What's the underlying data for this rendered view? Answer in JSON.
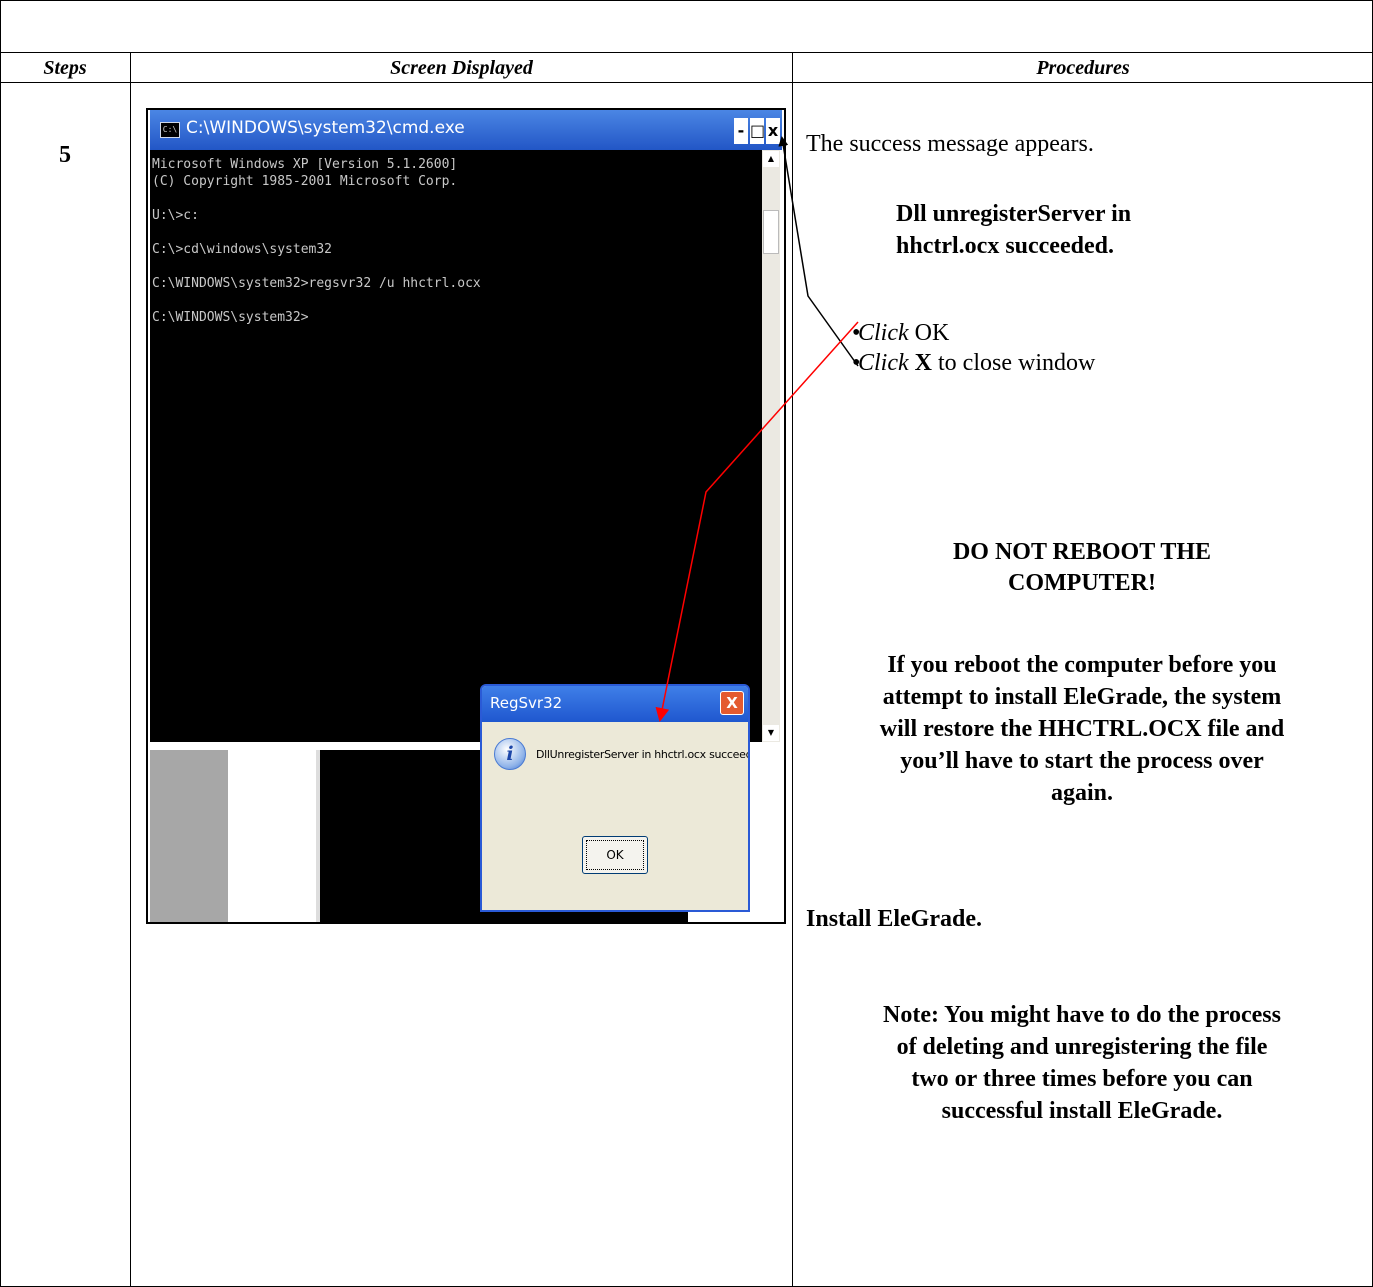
{
  "table": {
    "headers": {
      "steps": "Steps",
      "screen": "Screen Displayed",
      "procedures": "Procedures"
    },
    "step_number": "5"
  },
  "screenshot": {
    "cmd_window": {
      "title": "C:\\WINDOWS\\system32\\cmd.exe",
      "icon_label": "C:\\",
      "buttons": {
        "minimize": "-",
        "maximize": "□",
        "close": "x"
      },
      "console_lines": [
        "Microsoft Windows XP [Version 5.1.2600]",
        "(C) Copyright 1985-2001 Microsoft Corp.",
        "",
        "U:\\>c:",
        "",
        "C:\\>cd\\windows\\system32",
        "",
        "C:\\WINDOWS\\system32>regsvr32 /u hhctrl.ocx",
        "",
        "C:\\WINDOWS\\system32>"
      ],
      "scroll_up": "▲",
      "scroll_down": "▼"
    },
    "dialog": {
      "title": "RegSvr32",
      "close_label": "X",
      "icon_glyph": "i",
      "message": "DllUnregisterServer in hhctrl.ocx succeeded.",
      "ok_label": "OK"
    }
  },
  "procedures": {
    "intro": "The success message appears.",
    "message_line1": "Dll unregisterServer in",
    "message_line2": "hhctrl.ocx succeeded.",
    "bullets": [
      {
        "verb": "Click",
        "object": "OK",
        "rest": ""
      },
      {
        "verb": "Click",
        "object": "X",
        "rest": " to close window"
      }
    ],
    "warning_line1": "DO NOT REBOOT THE",
    "warning_line2": "COMPUTER!",
    "reboot_line1": "If you reboot the computer before  you",
    "reboot_line2": "attempt to install EleGrade, the system",
    "reboot_line3": "will restore the HHCTRL.OCX file and",
    "reboot_line4": "you’ll have to start the process over",
    "reboot_line5": "again.",
    "install": "Install EleGrade.",
    "note_line1": "Note: You might have to do the process",
    "note_line2": "of deleting and unregistering the file",
    "note_line3": "two or three times before you can",
    "note_line4": "successful install EleGrade."
  }
}
